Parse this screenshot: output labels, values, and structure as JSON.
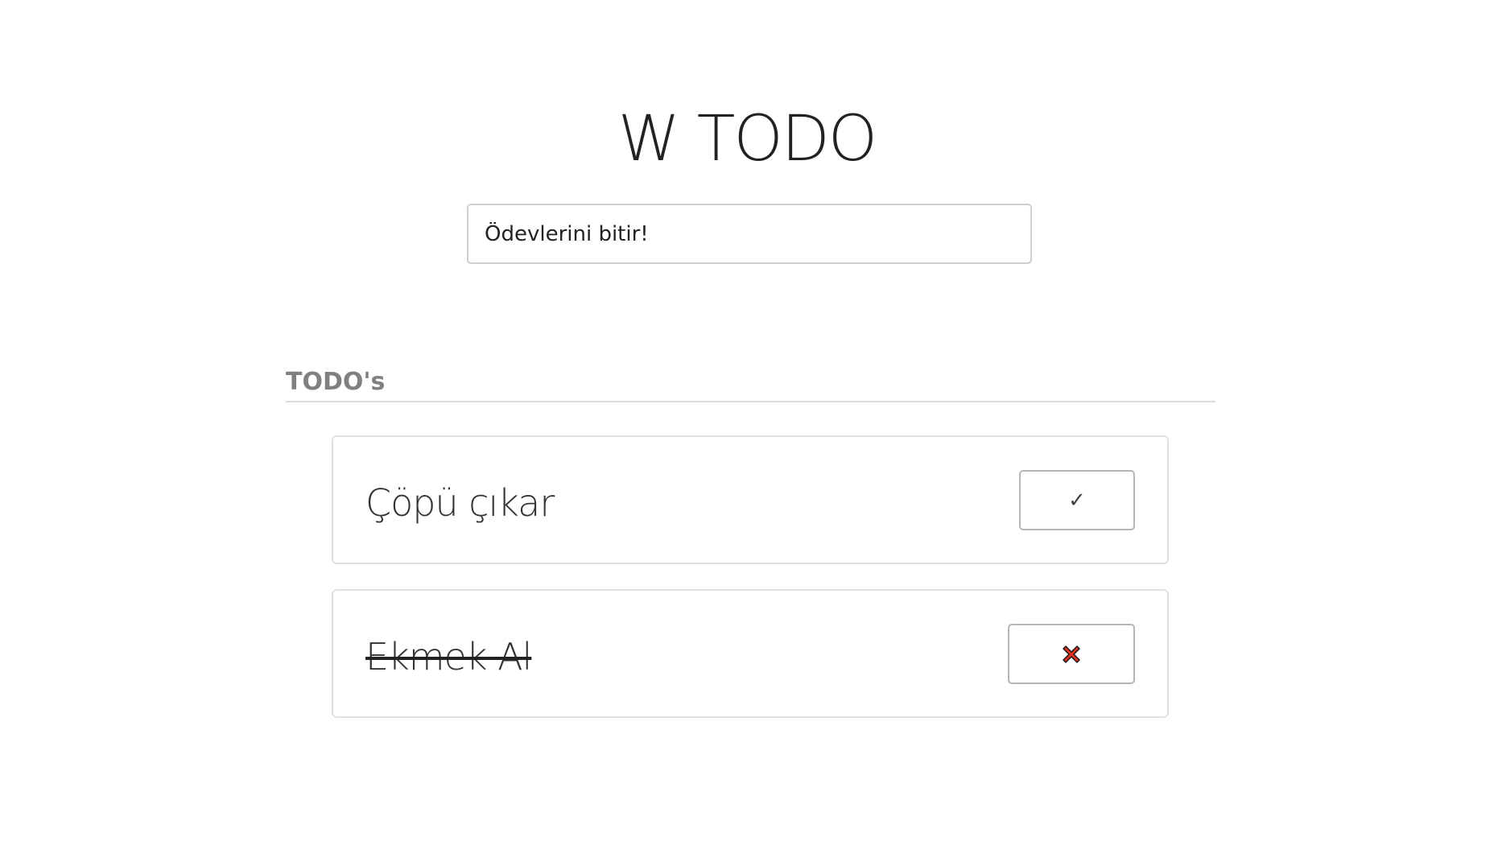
{
  "app": {
    "title": "W TODO"
  },
  "new_todo": {
    "value": "Ödevlerini bitir!",
    "placeholder": ""
  },
  "todos_section": {
    "title": "TODO's"
  },
  "todos": [
    {
      "text": "Çöpü çıkar",
      "completed": false,
      "action": "✓",
      "action_icon": "check-icon"
    },
    {
      "text": "Ekmek Al",
      "completed": true,
      "action": "",
      "action_icon": "cross-icon"
    }
  ],
  "colors": {
    "cross_fill": "#e0311f",
    "cross_outline": "#1a1a1a",
    "section_title": "#808080"
  }
}
